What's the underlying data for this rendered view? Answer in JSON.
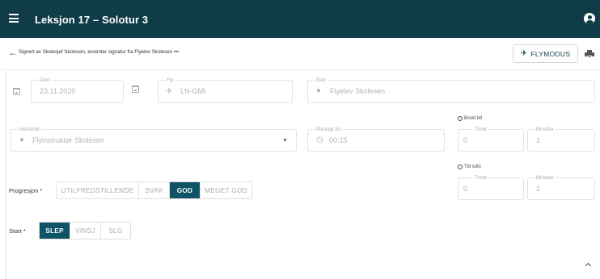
{
  "appbar": {
    "title": "Leksjon 17 – Solotur 3",
    "menu_icon": "menu-icon",
    "account_icon": "account-circle-icon"
  },
  "status": {
    "text": "Signert av Skolesjef Skolesen, avventer signatur fra Flyelev Skolesen •••",
    "flymodus_label": "FLYMODUS",
    "back_icon": "arrow-left-icon",
    "print_icon": "printer-icon"
  },
  "form": {
    "dato": {
      "label": "Dato",
      "value": "23.11.2020"
    },
    "fly": {
      "label": "Fly",
      "value": "LN-GMI"
    },
    "elev": {
      "label": "Elev",
      "value": "Flyelev Skolesen"
    },
    "instruktor": {
      "label": "Instruktør",
      "value": "Flyinstruktør Skolesen"
    },
    "planlagt_tid": {
      "label": "Planlagt tid",
      "value": "00:15"
    },
    "brukt_tid": {
      "title": "Brukt tid",
      "timer_label": "Timer",
      "timer_value": "0",
      "minutter_label": "Minutter",
      "minutter_value": "1"
    },
    "tid_solo": {
      "title": "Tid solo",
      "timer_label": "Timer",
      "timer_value": "0",
      "minutter_label": "Minutter",
      "minutter_value": "1"
    },
    "progresjon": {
      "label": "Progresjon *",
      "options": [
        "UTILFREDSTILLENDE",
        "SVAK",
        "GOD",
        "MEGET GOD"
      ],
      "selected": "GOD"
    },
    "start": {
      "label": "Start *",
      "options": [
        "SLEP",
        "VINSJ",
        "SLG"
      ],
      "selected": "SLEP"
    }
  },
  "colors": {
    "appbar": "#0f3c46",
    "selected_segment": "#0f5366"
  }
}
